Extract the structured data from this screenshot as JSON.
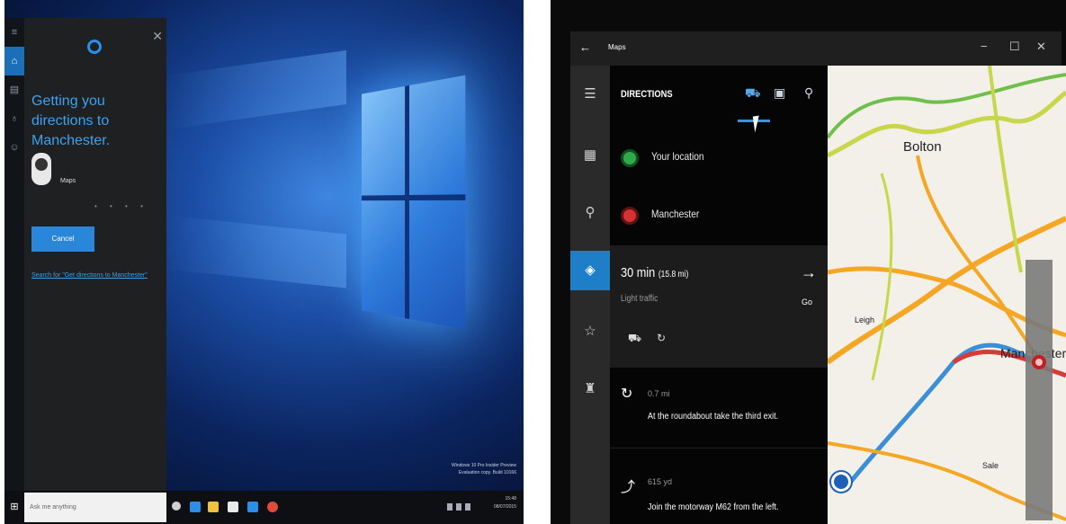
{
  "left_screen": {
    "cortana": {
      "heading": "Getting you directions to Manchester.",
      "app_name": "Maps",
      "cancel_label": "Cancel",
      "search_link": "Search for \"Get directions to Manchester\"",
      "close_glyph": "✕"
    },
    "rail_icons": [
      "menu-icon",
      "home-icon",
      "notebook-icon",
      "reminders-icon",
      "feedback-icon"
    ],
    "desktop_watermark": [
      "Windows 10 Pro Insider Preview",
      "Evaluation copy. Build 10166",
      "15:48",
      "08/07/2015"
    ],
    "taskbar": {
      "search_placeholder": "Ask me anything",
      "start_glyph": "⊞",
      "app_icons": [
        {
          "name": "task-view-icon",
          "color": "#d0d0d0"
        },
        {
          "name": "edge-icon",
          "color": "#2b8ee8"
        },
        {
          "name": "file-explorer-icon",
          "color": "#f0c040"
        },
        {
          "name": "store-icon",
          "color": "#e8e8e8"
        },
        {
          "name": "maps-taskbar-icon",
          "color": "#2b8ee8"
        },
        {
          "name": "chrome-icon",
          "color": "#e04a3a"
        }
      ]
    }
  },
  "right_screen": {
    "window_title": "Maps",
    "back_glyph": "←",
    "controls": {
      "minimize": "−",
      "maximize": "☐",
      "close": "✕"
    },
    "panel": {
      "heading": "DIRECTIONS",
      "start": "Your location",
      "destination": "Manchester",
      "route": {
        "time": "30 min",
        "distance": "(15.8 mi)",
        "traffic": "Light traffic",
        "go_label": "Go"
      },
      "steps": [
        {
          "distance": "0.7 mi",
          "instruction": "At the roundabout take the third exit."
        },
        {
          "distance": "615 yd",
          "instruction": "Join the motorway M62 from the left."
        }
      ]
    },
    "nav_icons": [
      "hamburger-menu-icon",
      "map-view-icon",
      "search-icon",
      "directions-icon",
      "favorites-icon",
      "traffic-cam-icon"
    ],
    "map": {
      "labels": {
        "bolton": "Bolton",
        "leigh": "Leigh",
        "manchester": "Manchester",
        "sale": "Sale"
      },
      "road_colors": {
        "motorway": "#f5a623",
        "a_road": "#c6d84a",
        "trunk": "#3a8fd6",
        "congested": "#d83a3a"
      }
    }
  }
}
